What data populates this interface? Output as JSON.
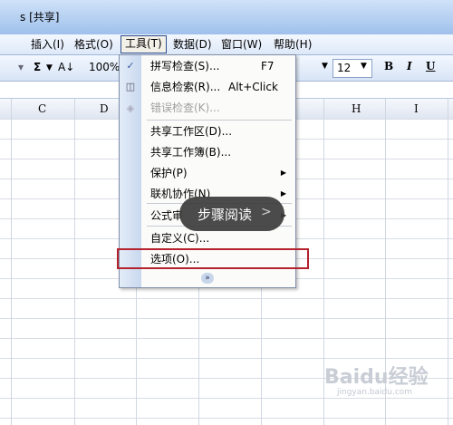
{
  "window": {
    "title": "s [共享]"
  },
  "menubar": [
    {
      "label": "插入(I)"
    },
    {
      "label": "格式(O)"
    },
    {
      "label": "工具(T)"
    },
    {
      "label": "数据(D)"
    },
    {
      "label": "窗口(W)"
    },
    {
      "label": "帮助(H)"
    }
  ],
  "toolbar": {
    "sum_label": "Σ",
    "zoom": "100%",
    "font_size": "12",
    "bold": "B",
    "italic": "I",
    "underline": "U"
  },
  "columns": [
    "C",
    "D",
    "H",
    "I"
  ],
  "tools_menu": {
    "spell_check": {
      "label": "拼写检查(S)...",
      "shortcut": "F7"
    },
    "research": {
      "label": "信息检索(R)...",
      "shortcut": "Alt+Click"
    },
    "error_check": {
      "label": "错误检查(K)..."
    },
    "shared_workspace": {
      "label": "共享工作区(D)..."
    },
    "share_workbook": {
      "label": "共享工作簿(B)..."
    },
    "protection": {
      "label": "保护(P)"
    },
    "online_collab": {
      "label": "联机协作(N)"
    },
    "formula_audit": {
      "label": "公式审"
    },
    "customize": {
      "label": "自定义(C)..."
    },
    "options": {
      "label": "选项(O)..."
    }
  },
  "overlay": {
    "step_label": "步骤阅读",
    "arrow": ">"
  },
  "watermark": {
    "brand": "Baidu经验",
    "url": "jingyan.baidu.com"
  }
}
